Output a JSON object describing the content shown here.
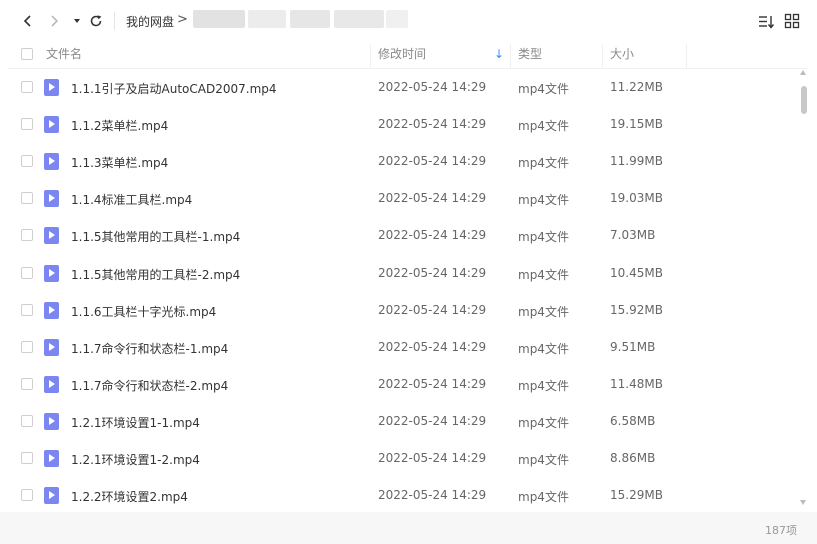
{
  "toolbar": {
    "back_icon": "chevron-left-icon",
    "forward_icon": "chevron-right-icon",
    "dropdown_icon": "caret-down-icon",
    "refresh_icon": "refresh-icon",
    "breadcrumb_root": "我的网盘",
    "breadcrumb_separator": ">",
    "sort_icon": "sort-list-icon",
    "grid_icon": "grid-view-icon"
  },
  "table": {
    "columns": {
      "name": "文件名",
      "modified": "修改时间",
      "type": "类型",
      "size": "大小"
    },
    "sort_indicator": "↓",
    "rows": [
      {
        "name": "1.1.1引子及启动AutoCAD2007.mp4",
        "modified": "2022-05-24 14:29",
        "type": "mp4文件",
        "size": "11.22MB"
      },
      {
        "name": "1.1.2菜单栏.mp4",
        "modified": "2022-05-24 14:29",
        "type": "mp4文件",
        "size": "19.15MB"
      },
      {
        "name": "1.1.3菜单栏.mp4",
        "modified": "2022-05-24 14:29",
        "type": "mp4文件",
        "size": "11.99MB"
      },
      {
        "name": "1.1.4标准工具栏.mp4",
        "modified": "2022-05-24 14:29",
        "type": "mp4文件",
        "size": "19.03MB"
      },
      {
        "name": "1.1.5其他常用的工具栏-1.mp4",
        "modified": "2022-05-24 14:29",
        "type": "mp4文件",
        "size": "7.03MB"
      },
      {
        "name": "1.1.5其他常用的工具栏-2.mp4",
        "modified": "2022-05-24 14:29",
        "type": "mp4文件",
        "size": "10.45MB"
      },
      {
        "name": "1.1.6工具栏十字光标.mp4",
        "modified": "2022-05-24 14:29",
        "type": "mp4文件",
        "size": "15.92MB"
      },
      {
        "name": "1.1.7命令行和状态栏-1.mp4",
        "modified": "2022-05-24 14:29",
        "type": "mp4文件",
        "size": "9.51MB"
      },
      {
        "name": "1.1.7命令行和状态栏-2.mp4",
        "modified": "2022-05-24 14:29",
        "type": "mp4文件",
        "size": "11.48MB"
      },
      {
        "name": "1.2.1环境设置1-1.mp4",
        "modified": "2022-05-24 14:29",
        "type": "mp4文件",
        "size": "6.58MB"
      },
      {
        "name": "1.2.1环境设置1-2.mp4",
        "modified": "2022-05-24 14:29",
        "type": "mp4文件",
        "size": "8.86MB"
      },
      {
        "name": "1.2.2环境设置2.mp4",
        "modified": "2022-05-24 14:29",
        "type": "mp4文件",
        "size": "15.29MB"
      }
    ]
  },
  "footer": {
    "item_count": "187项"
  },
  "colors": {
    "file_icon": "#7b86f0",
    "sort_arrow": "#3b8cff"
  }
}
